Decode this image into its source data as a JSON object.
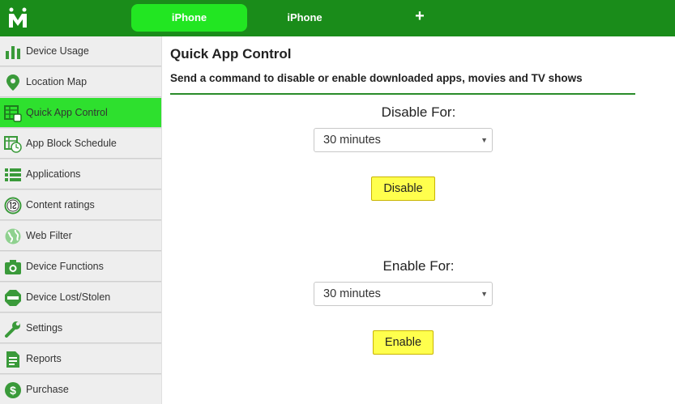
{
  "header": {
    "tabs": [
      {
        "label": "iPhone",
        "active": true
      },
      {
        "label": "iPhone",
        "active": false
      },
      {
        "label": "+",
        "active": false
      }
    ]
  },
  "sidebar": {
    "items": [
      {
        "label": "Device Usage",
        "icon": "bar-chart-icon"
      },
      {
        "label": "Location Map",
        "icon": "map-pin-icon"
      },
      {
        "label": "Quick App Control",
        "icon": "app-control-icon",
        "active": true
      },
      {
        "label": "App Block Schedule",
        "icon": "schedule-icon"
      },
      {
        "label": "Applications",
        "icon": "list-icon"
      },
      {
        "label": "Content ratings",
        "icon": "rating-icon"
      },
      {
        "label": "Web Filter",
        "icon": "globe-icon"
      },
      {
        "label": "Device Functions",
        "icon": "camera-icon"
      },
      {
        "label": "Device Lost/Stolen",
        "icon": "stop-icon"
      },
      {
        "label": "Settings",
        "icon": "wrench-icon"
      },
      {
        "label": "Reports",
        "icon": "report-icon"
      },
      {
        "label": "Purchase",
        "icon": "dollar-icon"
      }
    ]
  },
  "main": {
    "title": "Quick App Control",
    "description": "Send a command to disable or enable downloaded apps, movies and TV shows",
    "disable": {
      "label": "Disable For:",
      "selected": "30 minutes",
      "button": "Disable"
    },
    "enable": {
      "label": "Enable For:",
      "selected": "30 minutes",
      "button": "Enable"
    }
  },
  "colors": {
    "topbar": "#1a8c1a",
    "active_green": "#2ee02e",
    "button_yellow": "#ffff4d"
  }
}
